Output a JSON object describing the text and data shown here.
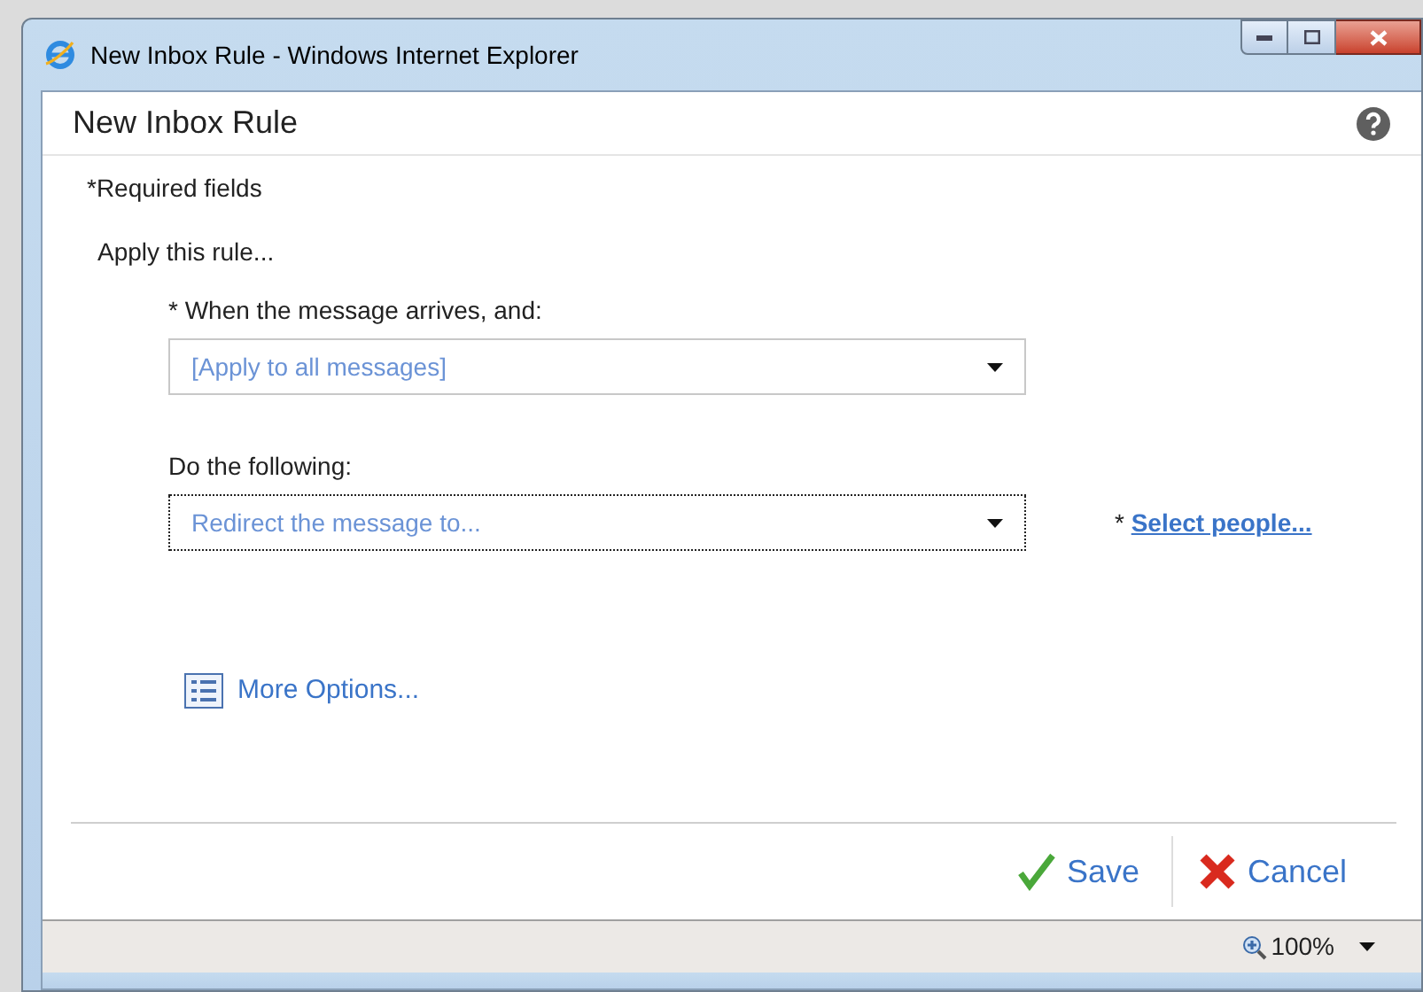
{
  "window": {
    "title": "New Inbox Rule - Windows Internet Explorer"
  },
  "dialog": {
    "title": "New Inbox Rule",
    "required_note": "*Required fields",
    "section": "Apply this rule...",
    "fields": [
      {
        "label": "* When the message arrives, and:",
        "value": "[Apply to all messages]",
        "focused": false
      },
      {
        "label": "Do the following:",
        "value": "Redirect the message to...",
        "focused": true,
        "link_prefix": "* ",
        "link": "Select people..."
      }
    ],
    "more_options": "More Options...",
    "buttons": [
      {
        "kind": "save",
        "label": "Save"
      },
      {
        "kind": "cancel",
        "label": "Cancel"
      }
    ]
  },
  "status_bar": {
    "zoom": "100%"
  }
}
